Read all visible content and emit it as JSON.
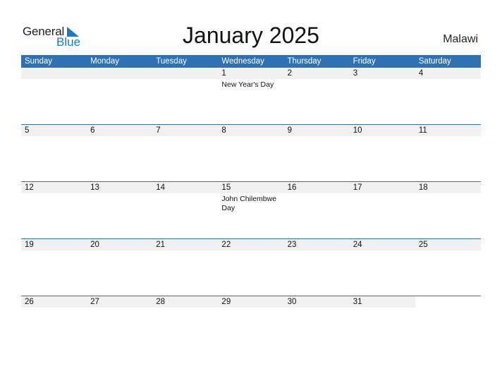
{
  "logo": {
    "line1": "General",
    "line2": "Blue"
  },
  "title": "January 2025",
  "country": "Malawi",
  "colors": {
    "header": "#2f72b4",
    "band": "#f1f1f1",
    "brand_blue": "#1a7ac7"
  },
  "weekdays": [
    "Sunday",
    "Monday",
    "Tuesday",
    "Wednesday",
    "Thursday",
    "Friday",
    "Saturday"
  ],
  "weeks": [
    {
      "days": [
        {
          "num": "",
          "event": ""
        },
        {
          "num": "",
          "event": ""
        },
        {
          "num": "",
          "event": ""
        },
        {
          "num": "1",
          "event": "New Year's Day"
        },
        {
          "num": "2",
          "event": ""
        },
        {
          "num": "3",
          "event": ""
        },
        {
          "num": "4",
          "event": ""
        }
      ]
    },
    {
      "days": [
        {
          "num": "5",
          "event": ""
        },
        {
          "num": "6",
          "event": ""
        },
        {
          "num": "7",
          "event": ""
        },
        {
          "num": "8",
          "event": ""
        },
        {
          "num": "9",
          "event": ""
        },
        {
          "num": "10",
          "event": ""
        },
        {
          "num": "11",
          "event": ""
        }
      ]
    },
    {
      "days": [
        {
          "num": "12",
          "event": ""
        },
        {
          "num": "13",
          "event": ""
        },
        {
          "num": "14",
          "event": ""
        },
        {
          "num": "15",
          "event": "John Chilembwe Day"
        },
        {
          "num": "16",
          "event": ""
        },
        {
          "num": "17",
          "event": ""
        },
        {
          "num": "18",
          "event": ""
        }
      ]
    },
    {
      "days": [
        {
          "num": "19",
          "event": ""
        },
        {
          "num": "20",
          "event": ""
        },
        {
          "num": "21",
          "event": ""
        },
        {
          "num": "22",
          "event": ""
        },
        {
          "num": "23",
          "event": ""
        },
        {
          "num": "24",
          "event": ""
        },
        {
          "num": "25",
          "event": ""
        }
      ]
    },
    {
      "days": [
        {
          "num": "26",
          "event": ""
        },
        {
          "num": "27",
          "event": ""
        },
        {
          "num": "28",
          "event": ""
        },
        {
          "num": "29",
          "event": ""
        },
        {
          "num": "30",
          "event": ""
        },
        {
          "num": "31",
          "event": ""
        },
        {
          "num": "",
          "event": ""
        }
      ]
    }
  ]
}
